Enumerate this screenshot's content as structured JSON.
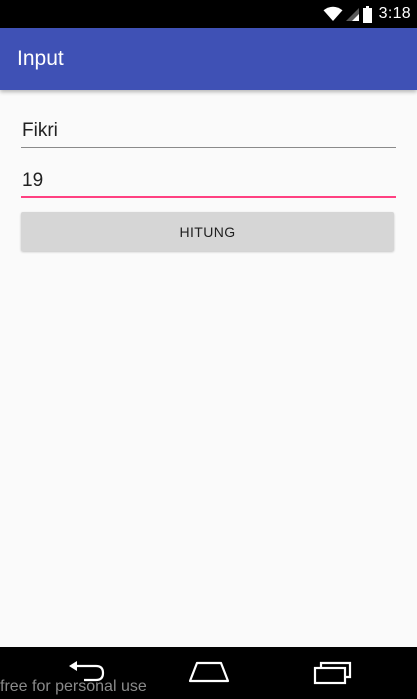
{
  "status_bar": {
    "time": "3:18",
    "icons": [
      "wifi-icon",
      "signal-icon",
      "battery-icon"
    ]
  },
  "app_bar": {
    "title": "Input",
    "color": "#3F51B5"
  },
  "form": {
    "name_value": "Fikri",
    "age_value": "19",
    "hitung_label": "HITUNG"
  },
  "colors": {
    "accent": "#FF4081",
    "primary": "#3F51B5"
  },
  "nav_bar": {
    "icons": [
      "back-icon",
      "home-icon",
      "recent-apps-icon"
    ]
  },
  "watermark": {
    "text": "free for personal use"
  }
}
